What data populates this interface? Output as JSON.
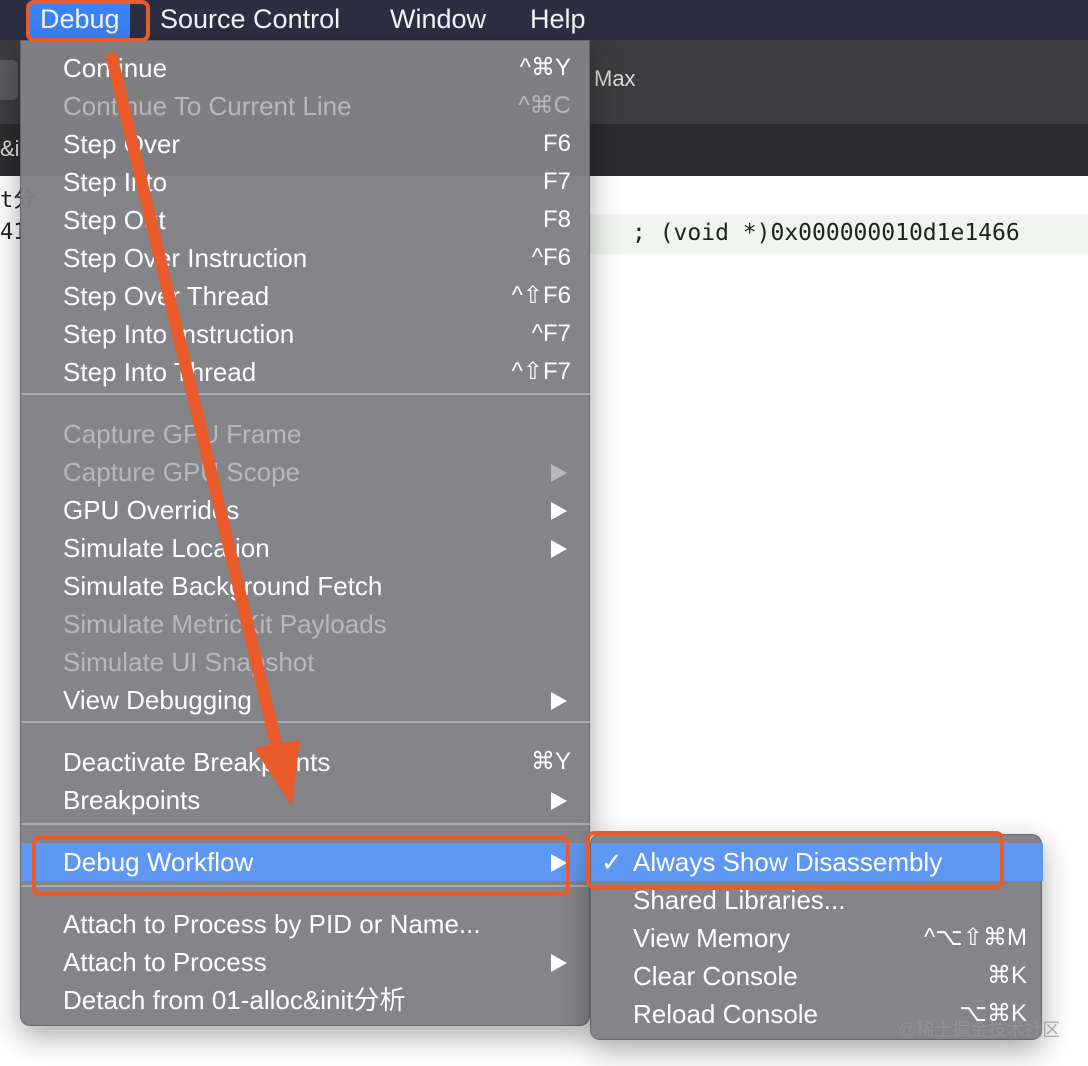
{
  "menubar": {
    "items": [
      {
        "label": "Debug",
        "active": true
      },
      {
        "label": "Source Control"
      },
      {
        "label": "Window"
      },
      {
        "label": "Help"
      }
    ]
  },
  "background": {
    "scheme_fragment": "Max",
    "tab_fragment": "&i",
    "code_fragment_1": "t分",
    "code_fragment_2": "41",
    "code_line": "; (void *)0x000000010d1e1466"
  },
  "debug_menu": {
    "items": [
      {
        "label": "Continue",
        "shortcut": "^⌘Y",
        "disabled": false
      },
      {
        "label": "Continue To Current Line",
        "shortcut": "^⌘C",
        "disabled": true
      },
      {
        "label": "Step Over",
        "shortcut": "F6",
        "disabled": false
      },
      {
        "label": "Step Into",
        "shortcut": "F7",
        "disabled": false
      },
      {
        "label": "Step Out",
        "shortcut": "F8",
        "disabled": false
      },
      {
        "label": "Step Over Instruction",
        "shortcut": "^F6",
        "disabled": false
      },
      {
        "label": "Step Over Thread",
        "shortcut": "^⇧F6",
        "disabled": false
      },
      {
        "label": "Step Into Instruction",
        "shortcut": "^F7",
        "disabled": false
      },
      {
        "label": "Step Into Thread",
        "shortcut": "^⇧F7",
        "disabled": false
      },
      {
        "label": "Capture GPU Frame",
        "shortcut": "",
        "disabled": true
      },
      {
        "label": "Capture GPU Scope",
        "submenu": true,
        "disabled": true
      },
      {
        "label": "GPU Overrides",
        "submenu": true,
        "disabled": false
      },
      {
        "label": "Simulate Location",
        "submenu": true,
        "disabled": false
      },
      {
        "label": "Simulate Background Fetch",
        "disabled": false
      },
      {
        "label": "Simulate MetricKit Payloads",
        "disabled": true
      },
      {
        "label": "Simulate UI Snapshot",
        "disabled": true
      },
      {
        "label": "View Debugging",
        "submenu": true,
        "disabled": false
      },
      {
        "label": "Deactivate Breakpoints",
        "shortcut": "⌘Y",
        "disabled": false
      },
      {
        "label": "Breakpoints",
        "submenu": true,
        "disabled": false
      },
      {
        "label": "Debug Workflow",
        "submenu": true,
        "disabled": false,
        "highlighted": true
      },
      {
        "label": "Attach to Process by PID or Name...",
        "disabled": false
      },
      {
        "label": "Attach to Process",
        "submenu": true,
        "disabled": false
      },
      {
        "label": "Detach from 01-alloc&init分析",
        "disabled": false
      }
    ]
  },
  "workflow_submenu": {
    "items": [
      {
        "label": "Always Show Disassembly",
        "checked": true,
        "check_mark": "✓",
        "highlighted": true,
        "shortcut": ""
      },
      {
        "label": "Shared Libraries...",
        "shortcut": ""
      },
      {
        "label": "View Memory",
        "shortcut": "^⌥⇧⌘M"
      },
      {
        "label": "Clear Console",
        "shortcut": "⌘K"
      },
      {
        "label": "Reload Console",
        "shortcut": "⌥⌘K"
      }
    ]
  },
  "colors": {
    "annotation": "#ea5a2a",
    "highlight": "#5f98f2",
    "menu_bg": "#808085",
    "menubar_bg": "#2a2f42"
  },
  "watermark": "@稀土掘金技术社区"
}
